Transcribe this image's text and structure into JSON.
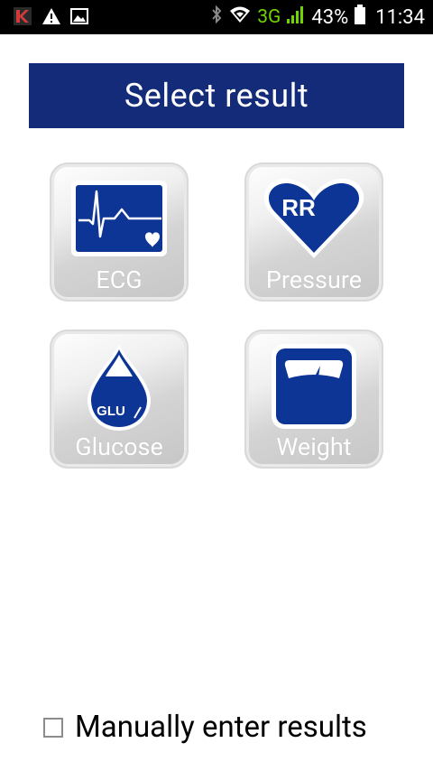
{
  "status_bar": {
    "network_type": "3G",
    "battery_percent": "43%",
    "time": "11:34",
    "icons": [
      "app-k-icon",
      "warning-icon",
      "image-icon",
      "bluetooth-icon",
      "wifi-icon",
      "signal-icon",
      "battery-icon"
    ]
  },
  "header": {
    "title": "Select result"
  },
  "tiles": [
    {
      "label": "ECG",
      "icon": "ecg-icon"
    },
    {
      "label": "Pressure",
      "icon": "heart-rr-icon",
      "icon_text": "RR"
    },
    {
      "label": "Glucose",
      "icon": "glucose-drop-icon",
      "icon_text": "GLU"
    },
    {
      "label": "Weight",
      "icon": "scale-icon"
    }
  ],
  "manual": {
    "label": "Manually enter results",
    "checked": false
  },
  "colors": {
    "brand_blue": "#142b7a",
    "icon_blue": "#0d3596",
    "network_green": "#6fd400"
  }
}
